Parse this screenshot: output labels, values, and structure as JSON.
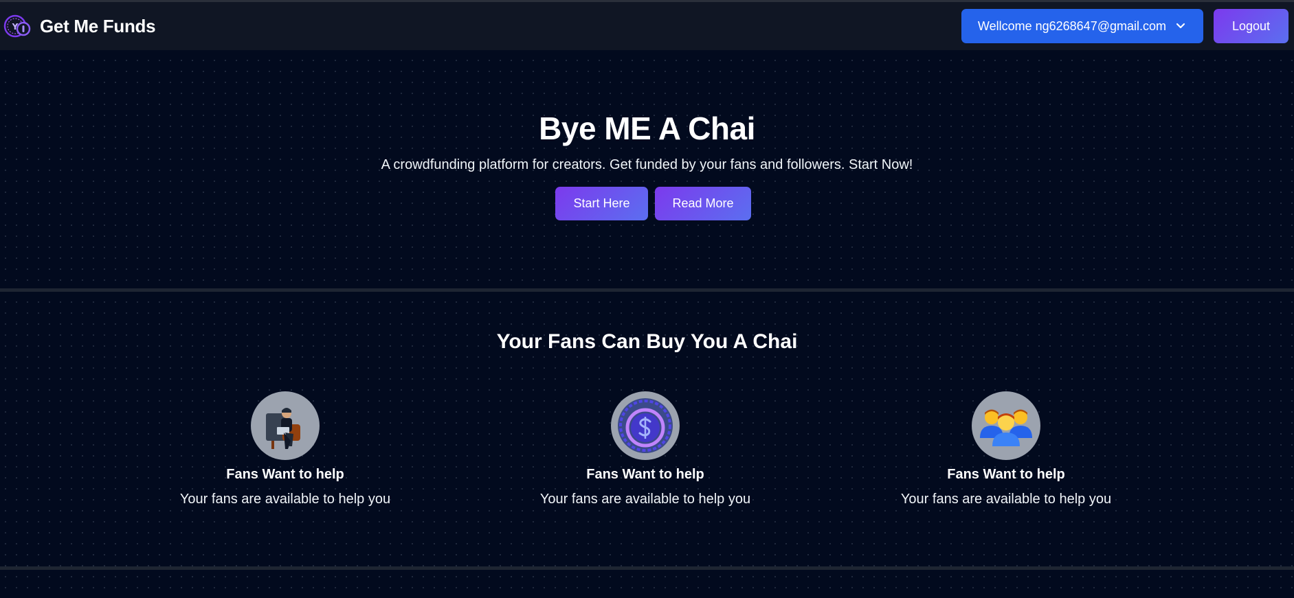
{
  "brand": {
    "name": "Get Me Funds",
    "icon": "coin-logo-icon"
  },
  "navbar": {
    "welcome_label": "Wellcome ng6268647@gmail.com",
    "logout_label": "Logout"
  },
  "hero": {
    "title": "Bye ME A Chai",
    "subtitle": "A crowdfunding platform for creators. Get funded by your fans and followers. Start Now!",
    "start_label": "Start Here",
    "read_label": "Read More"
  },
  "features": {
    "title": "Your Fans Can Buy You A Chai",
    "items": [
      {
        "icon": "man-with-laptop-icon",
        "heading": "Fans Want to help",
        "text": "Your fans are available to help you"
      },
      {
        "icon": "dollar-coin-icon",
        "heading": "Fans Want to help",
        "text": "Your fans are available to help you"
      },
      {
        "icon": "group-people-icon",
        "heading": "Fans Want to help",
        "text": "Your fans are available to help you"
      }
    ]
  },
  "colors": {
    "background": "#020a1e",
    "navbar": "#101624",
    "primary_blue": "#2563eb",
    "accent_purple": "#7c3aed"
  }
}
